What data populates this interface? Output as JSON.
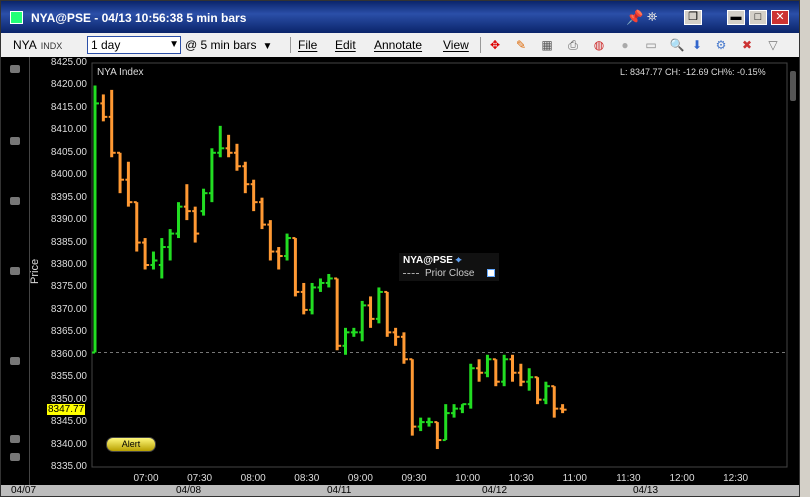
{
  "window": {
    "title": "NYA@PSE - 04/13 10:56:38 5 min bars",
    "controls": {
      "pin": "pin-icon",
      "dock": "dock-icon",
      "restore": "❐",
      "minimize": "▬",
      "maximize": "□",
      "close": "✕"
    }
  },
  "toolbar": {
    "symbol": "NYA",
    "exchange": "INDX",
    "period": "1 day",
    "bar_size": "@ 5 min bars",
    "menus": [
      "File",
      "Edit",
      "Annotate",
      "View"
    ],
    "icons": [
      "crosshair-icon",
      "pencil-icon",
      "grid-icon",
      "print-icon",
      "palette-icon",
      "circle-icon",
      "zoom-icon",
      "down-icon",
      "close-x-icon",
      "triangle-down-icon"
    ]
  },
  "chart": {
    "name": "NYA Index",
    "quote": "L: 8347.77 CH: -12.69 CH%: -0.15%",
    "last_price_tag": "8347.77",
    "alert_label": "Alert",
    "legend_title": "NYA@PSE",
    "legend_line": "Prior Close",
    "ylabel": "Price",
    "colors": {
      "up": "#22dd22",
      "down": "#ff9933",
      "prior_close": "#777777"
    }
  },
  "chart_data": {
    "type": "bar",
    "ylabel": "Price",
    "ylim": [
      8335,
      8425
    ],
    "yticks": [
      "8425.00",
      "8420.00",
      "8415.00",
      "8410.00",
      "8405.00",
      "8400.00",
      "8395.00",
      "8390.00",
      "8385.00",
      "8380.00",
      "8375.00",
      "8370.00",
      "8365.00",
      "8360.00",
      "8355.00",
      "8350.00",
      "8345.00",
      "8340.00",
      "8335.00"
    ],
    "xticks": [
      "07:00",
      "07:30",
      "08:00",
      "08:30",
      "09:00",
      "09:30",
      "10:00",
      "10:30",
      "11:00",
      "11:30",
      "12:00",
      "12:30"
    ],
    "date_labels": [
      "04/07",
      "04/08",
      "04/11",
      "04/12",
      "04/13"
    ],
    "prior_close": 8360.5,
    "bars": [
      {
        "o": 8360.5,
        "h": 8420,
        "l": 8360.5,
        "c": 8416
      },
      {
        "o": 8416,
        "h": 8418,
        "l": 8412,
        "c": 8413
      },
      {
        "o": 8413,
        "h": 8419,
        "l": 8404,
        "c": 8405
      },
      {
        "o": 8405,
        "h": 8404,
        "l": 8396,
        "c": 8399
      },
      {
        "o": 8399,
        "h": 8403,
        "l": 8393,
        "c": 8394
      },
      {
        "o": 8394,
        "h": 8392,
        "l": 8383,
        "c": 8385
      },
      {
        "o": 8385,
        "h": 8386,
        "l": 8379,
        "c": 8380
      },
      {
        "o": 8380,
        "h": 8383,
        "l": 8379,
        "c": 8381
      },
      {
        "o": 8380,
        "h": 8386,
        "l": 8377,
        "c": 8384
      },
      {
        "o": 8384,
        "h": 8388,
        "l": 8381,
        "c": 8387
      },
      {
        "o": 8387,
        "h": 8394,
        "l": 8386,
        "c": 8393
      },
      {
        "o": 8393,
        "h": 8398,
        "l": 8390,
        "c": 8392
      },
      {
        "o": 8392,
        "h": 8393,
        "l": 8385,
        "c": 8387
      },
      {
        "o": 8392,
        "h": 8397,
        "l": 8391,
        "c": 8396
      },
      {
        "o": 8396,
        "h": 8406,
        "l": 8394,
        "c": 8405
      },
      {
        "o": 8405,
        "h": 8411,
        "l": 8404,
        "c": 8406
      },
      {
        "o": 8406,
        "h": 8409,
        "l": 8404,
        "c": 8405
      },
      {
        "o": 8405,
        "h": 8407,
        "l": 8401,
        "c": 8402
      },
      {
        "o": 8402,
        "h": 8403,
        "l": 8396,
        "c": 8398
      },
      {
        "o": 8398,
        "h": 8399,
        "l": 8392,
        "c": 8394
      },
      {
        "o": 8394,
        "h": 8395,
        "l": 8388,
        "c": 8389
      },
      {
        "o": 8389,
        "h": 8390,
        "l": 8381,
        "c": 8383
      },
      {
        "o": 8383,
        "h": 8384,
        "l": 8379,
        "c": 8382
      },
      {
        "o": 8382,
        "h": 8387,
        "l": 8381,
        "c": 8386
      },
      {
        "o": 8386,
        "h": 8386,
        "l": 8373,
        "c": 8374
      },
      {
        "o": 8374,
        "h": 8376,
        "l": 8369,
        "c": 8370
      },
      {
        "o": 8370,
        "h": 8376,
        "l": 8369,
        "c": 8375
      },
      {
        "o": 8375,
        "h": 8377,
        "l": 8374,
        "c": 8376
      },
      {
        "o": 8376,
        "h": 8378,
        "l": 8375,
        "c": 8377
      },
      {
        "o": 8377,
        "h": 8376,
        "l": 8361,
        "c": 8362
      },
      {
        "o": 8362,
        "h": 8366,
        "l": 8360,
        "c": 8365
      },
      {
        "o": 8365,
        "h": 8366,
        "l": 8364,
        "c": 8365
      },
      {
        "o": 8365,
        "h": 8372,
        "l": 8363,
        "c": 8371
      },
      {
        "o": 8371,
        "h": 8373,
        "l": 8366,
        "c": 8368
      },
      {
        "o": 8368,
        "h": 8375,
        "l": 8367,
        "c": 8374
      },
      {
        "o": 8374,
        "h": 8371,
        "l": 8364,
        "c": 8365
      },
      {
        "o": 8365,
        "h": 8366,
        "l": 8362,
        "c": 8364
      },
      {
        "o": 8364,
        "h": 8365,
        "l": 8358,
        "c": 8359
      },
      {
        "o": 8359,
        "h": 8358,
        "l": 8342,
        "c": 8344
      },
      {
        "o": 8344,
        "h": 8346,
        "l": 8343,
        "c": 8345
      },
      {
        "o": 8345,
        "h": 8346,
        "l": 8344,
        "c": 8345
      },
      {
        "o": 8345,
        "h": 8343,
        "l": 8339,
        "c": 8341
      },
      {
        "o": 8341,
        "h": 8349,
        "l": 8344,
        "c": 8347
      },
      {
        "o": 8347,
        "h": 8349,
        "l": 8346,
        "c": 8348
      },
      {
        "o": 8348,
        "h": 8349,
        "l": 8347,
        "c": 8349
      },
      {
        "o": 8349,
        "h": 8358,
        "l": 8348,
        "c": 8357
      },
      {
        "o": 8357,
        "h": 8359,
        "l": 8354,
        "c": 8356
      },
      {
        "o": 8356,
        "h": 8360,
        "l": 8355,
        "c": 8359
      },
      {
        "o": 8359,
        "h": 8359,
        "l": 8353,
        "c": 8354
      },
      {
        "o": 8354,
        "h": 8360,
        "l": 8353,
        "c": 8359
      },
      {
        "o": 8359,
        "h": 8360,
        "l": 8354,
        "c": 8356
      },
      {
        "o": 8356,
        "h": 8358,
        "l": 8353,
        "c": 8354
      },
      {
        "o": 8354,
        "h": 8357,
        "l": 8352,
        "c": 8355
      },
      {
        "o": 8355,
        "h": 8354,
        "l": 8349,
        "c": 8350
      },
      {
        "o": 8350,
        "h": 8354,
        "l": 8349,
        "c": 8353
      },
      {
        "o": 8353,
        "h": 8353,
        "l": 8346,
        "c": 8348
      },
      {
        "o": 8348,
        "h": 8349,
        "l": 8347,
        "c": 8347.77
      }
    ]
  }
}
